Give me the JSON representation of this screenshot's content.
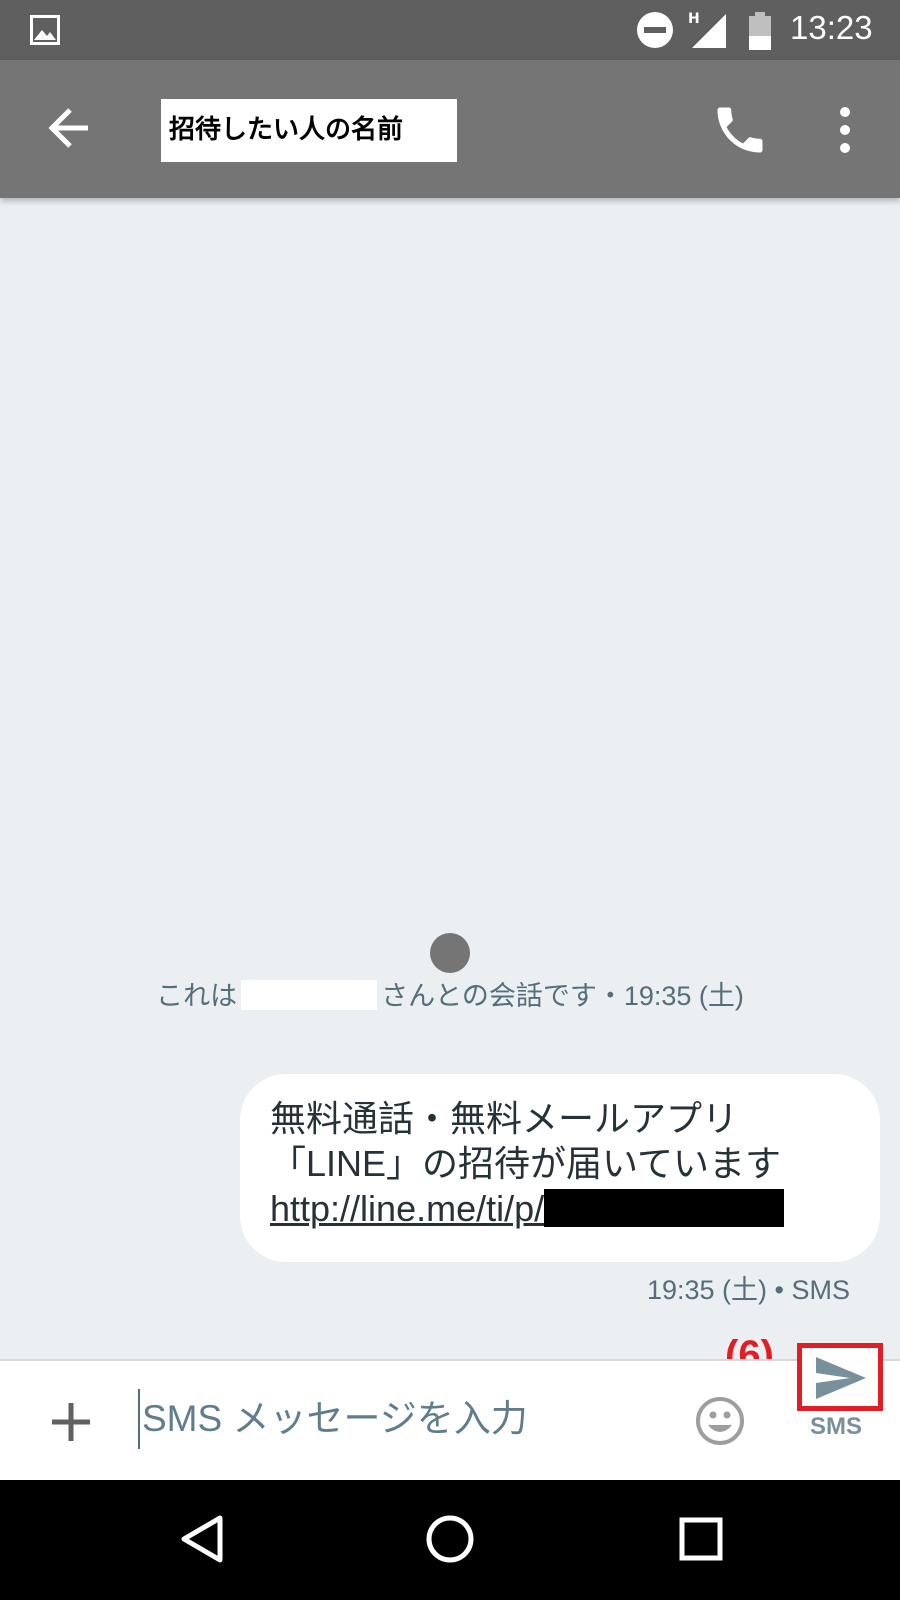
{
  "status_bar": {
    "time": "13:23",
    "network_label": "H",
    "icons": [
      "gallery-icon",
      "do-not-disturb-icon",
      "signal-icon",
      "battery-icon"
    ]
  },
  "app_bar": {
    "title": "招待したい人の名前",
    "icons": [
      "back-arrow-icon",
      "phone-icon",
      "more-vert-icon"
    ]
  },
  "conversation": {
    "info_prefix": "これは",
    "info_suffix": "さんとの会話です・19:35 (土)",
    "message": {
      "line1": "無料通話・無料メールアプリ",
      "line2": "「LINE」の招待が届いています",
      "link": "http://line.me/ti/p/"
    },
    "message_meta": "19:35 (土) • SMS"
  },
  "annotation": {
    "step_label": "(6)",
    "highlight_color": "#e01e24"
  },
  "compose": {
    "placeholder": "SMS メッセージを入力",
    "send_caption": "SMS",
    "icons": [
      "plus-icon",
      "emoji-icon",
      "send-icon"
    ]
  },
  "nav_bar": {
    "icons": [
      "nav-back-icon",
      "nav-home-icon",
      "nav-recents-icon"
    ]
  },
  "colors": {
    "status_bar": "#5f5f5f",
    "app_bar": "#757575",
    "background": "#eceff1",
    "bubble": "#ffffff",
    "secondary_text": "#546e7a"
  }
}
